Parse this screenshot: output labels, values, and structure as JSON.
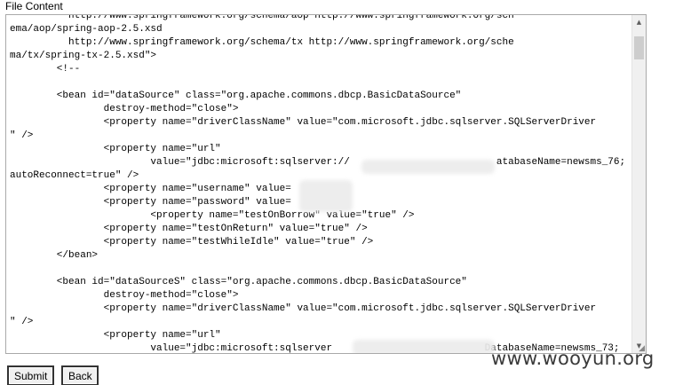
{
  "page": {
    "field_label": "File Content",
    "submit_label": "Submit",
    "back_label": "Back",
    "watermark": "www.wooyun.org"
  },
  "file_content": {
    "lines": [
      "          http://www.springframework.org/schema/aop http://www.springframework.org/sch",
      "ema/aop/spring-aop-2.5.xsd",
      "          http://www.springframework.org/schema/tx http://www.springframework.org/sche",
      "ma/tx/spring-tx-2.5.xsd\">",
      "\t<!--",
      "",
      "\t<bean id=\"dataSource\" class=\"org.apache.commons.dbcp.BasicDataSource\"",
      "\t\tdestroy-method=\"close\">",
      "\t\t<property name=\"driverClassName\" value=\"com.microsoft.jdbc.sqlserver.SQLServerDriver",
      "\" />",
      "\t\t<property name=\"url\"",
      "\t\t\tvalue=\"jdbc:microsoft:sqlserver://                         atabaseName=newsms_76;",
      "autoReconnect=true\" />",
      "\t\t<property name=\"username\" value=",
      "\t\t<property name=\"password\" value=",
      "\t\t\t<property name=\"testOnBorrow\" value=\"true\" />",
      "\t\t<property name=\"testOnReturn\" value=\"true\" />",
      "\t\t<property name=\"testWhileIdle\" value=\"true\" />",
      "\t</bean>",
      "",
      "\t<bean id=\"dataSourceS\" class=\"org.apache.commons.dbcp.BasicDataSource\"",
      "\t\tdestroy-method=\"close\">",
      "\t\t<property name=\"driverClassName\" value=\"com.microsoft.jdbc.sqlserver.SQLServerDriver",
      "\" />",
      "\t\t<property name=\"url\"",
      "\t\t\tvalue=\"jdbc:microsoft:sqlserver                          DatabaseName=newsms_73;"
    ]
  }
}
